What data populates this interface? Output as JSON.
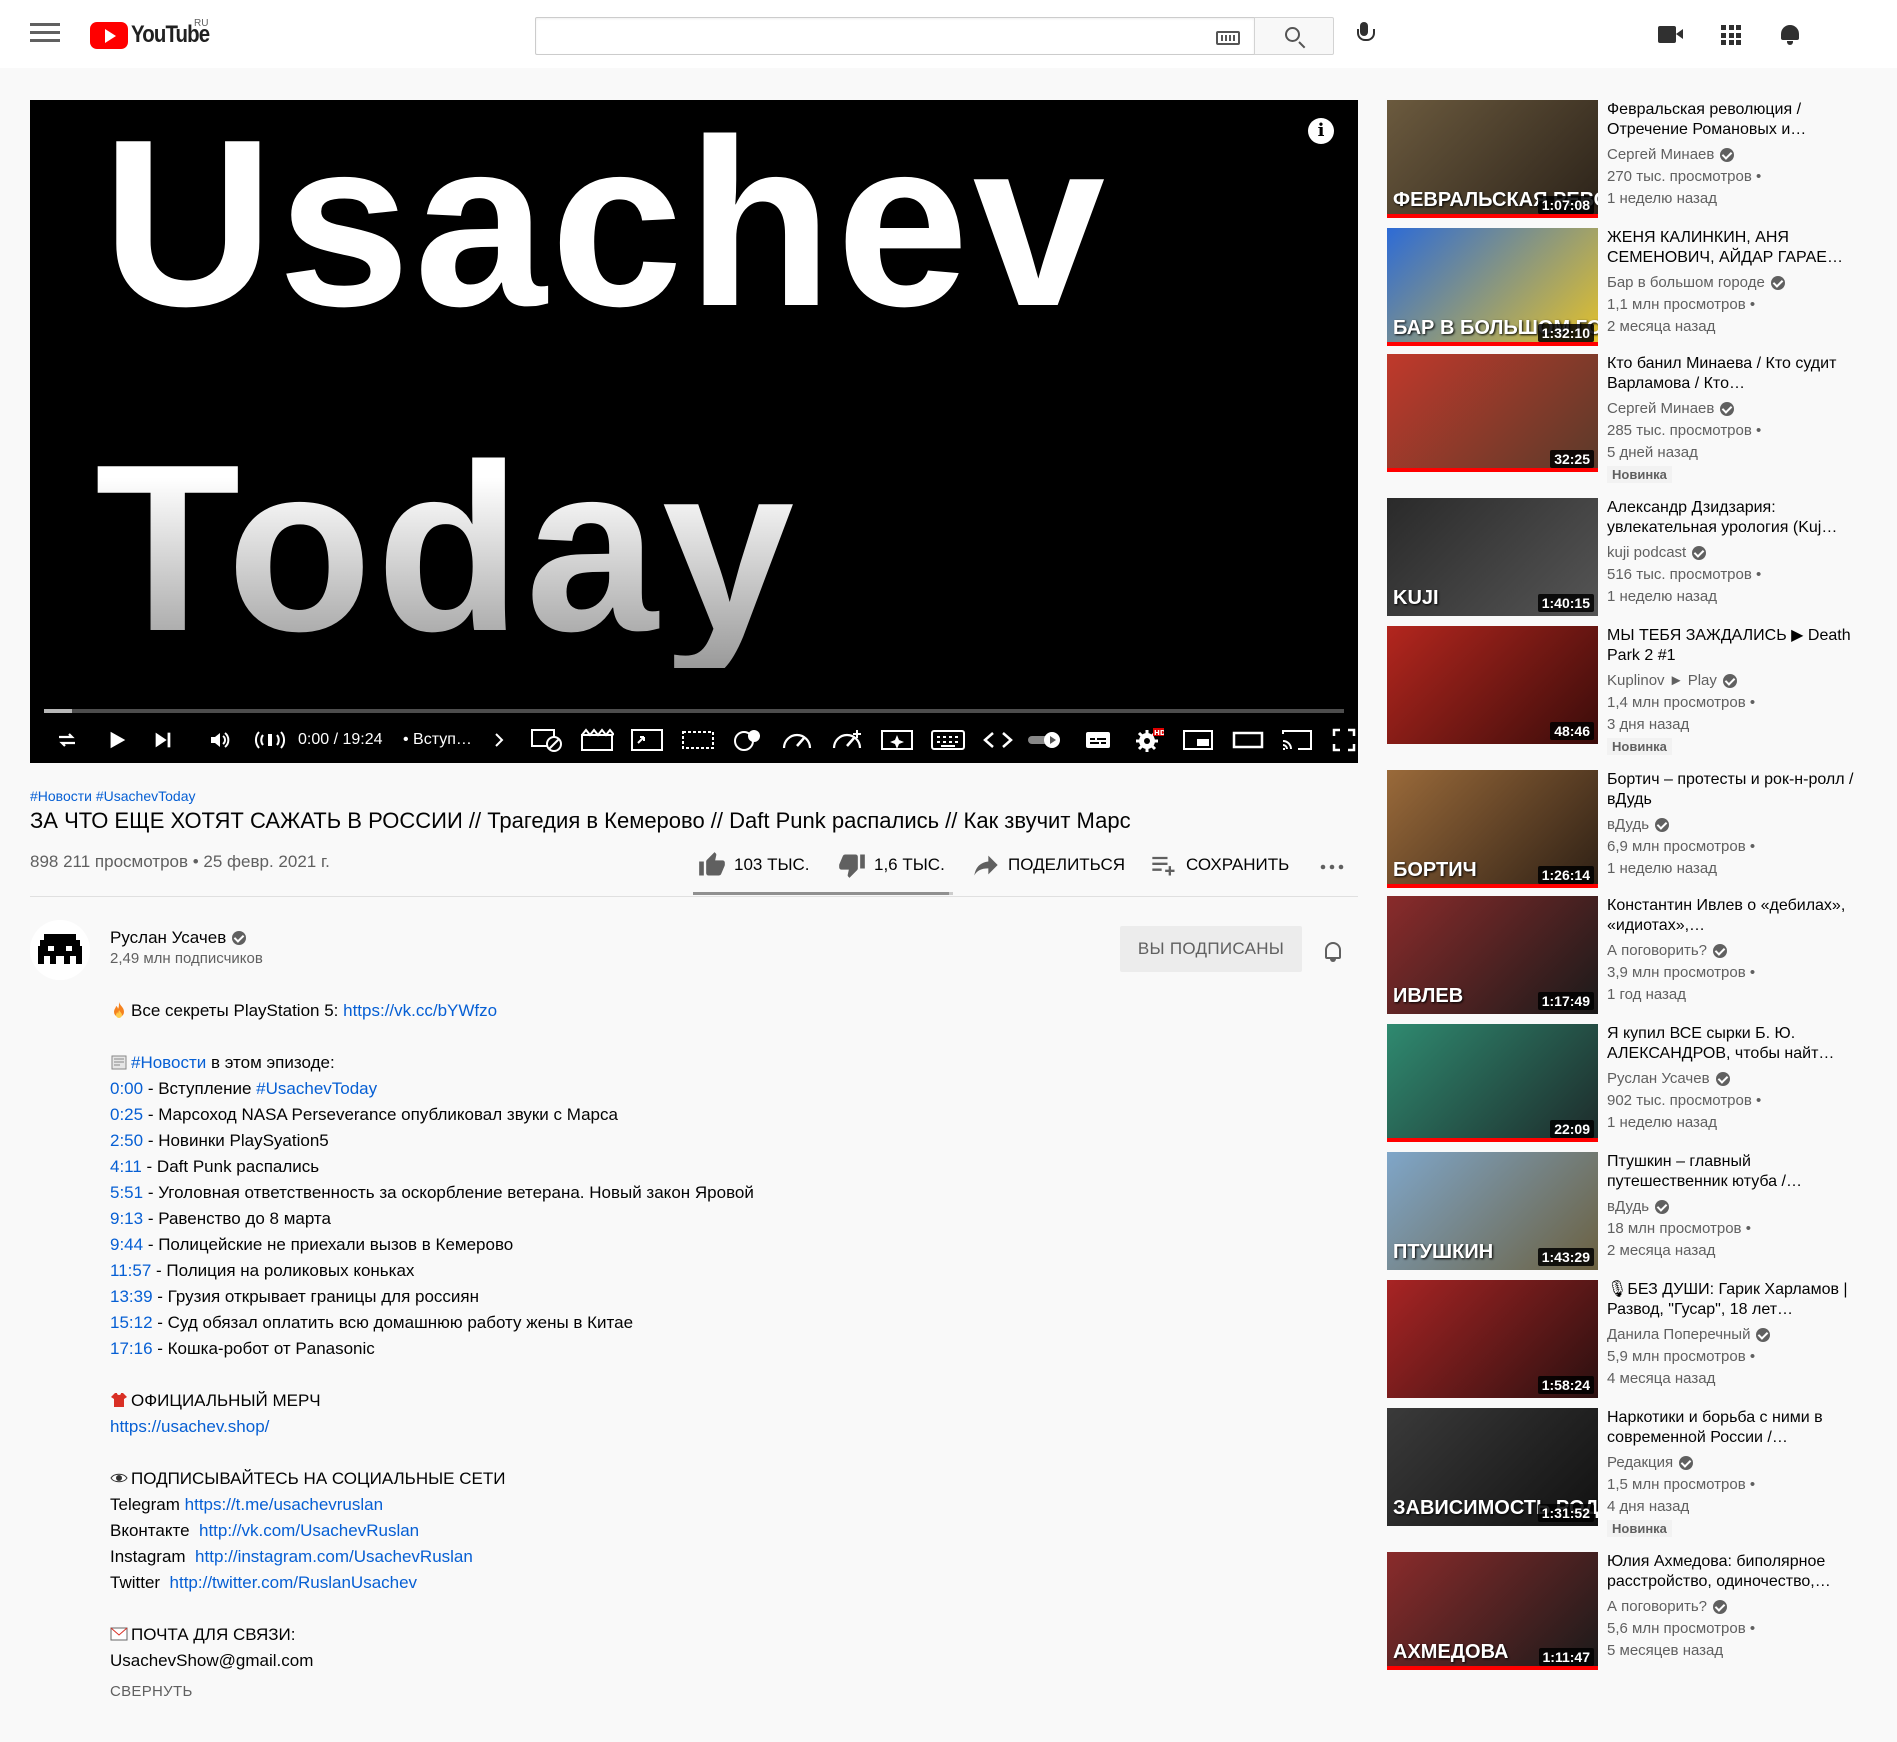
{
  "masthead": {
    "logo_text": "YouTube",
    "region": "RU",
    "search_value": ""
  },
  "player": {
    "thumb_line1": "Usachev",
    "thumb_line2": "Today",
    "time": "0:00 / 19:24",
    "chapter": "• Вступ…",
    "played_fraction": 0.0
  },
  "video": {
    "hashtags": [
      "#Новости",
      "#UsachevToday"
    ],
    "title": "ЗА ЧТО ЕЩЕ ХОТЯТ САЖАТЬ В РОССИИ // Трагедия в Кемерово // Daft Punk распались // Как звучит Марс",
    "views_date": "898 211 просмотров • 25 февр. 2021 г.",
    "likes": "103 ТЫС.",
    "dislikes": "1,6 ТЫС.",
    "share": "ПОДЕЛИТЬСЯ",
    "save": "СОХРАНИТЬ"
  },
  "channel": {
    "name": "Руслан Усачев",
    "subscribers": "2,49 млн подписчиков",
    "subscribed_label": "ВЫ ПОДПИСАНЫ"
  },
  "description": {
    "ps5_text": "Все секреты PlayStation 5: ",
    "ps5_link": "https://vk.cc/bYWfzo",
    "news_tag": "#Новости",
    "news_text": " в этом эпизоде:",
    "chapters": [
      {
        "time": "0:00",
        "text": " - Вступление ",
        "tag": "#UsachevToday"
      },
      {
        "time": "0:25",
        "text": " - Марсоход NASA Perseverance опубликовал звуки с Марса",
        "tag": ""
      },
      {
        "time": "2:50",
        "text": " - Новинки PlaySyation5",
        "tag": ""
      },
      {
        "time": "4:11",
        "text": " - Daft Punk распались",
        "tag": ""
      },
      {
        "time": "5:51",
        "text": " - Уголовная ответственность за оскорбление ветерана. Новый закон Яровой",
        "tag": ""
      },
      {
        "time": "9:13",
        "text": " - Равенство до 8 марта",
        "tag": ""
      },
      {
        "time": "9:44",
        "text": " - Полицейские не приехали вызов в Кемерово",
        "tag": ""
      },
      {
        "time": "11:57",
        "text": " - Полиция на роликовых коньках",
        "tag": ""
      },
      {
        "time": "13:39",
        "text": " - Грузия открывает границы для россиян",
        "tag": ""
      },
      {
        "time": "15:12",
        "text": " - Суд обязал оплатить всю домашнюю работу жены в Китае",
        "tag": ""
      },
      {
        "time": "17:16",
        "text": " - Кошка-робот от Panasonic",
        "tag": ""
      }
    ],
    "merch_title": "ОФИЦИАЛЬНЫЙ МЕРЧ",
    "merch_link": "https://usachev.shop/",
    "social_title": "ПОДПИСЫВАЙТЕСЬ НА СОЦИАЛЬНЫЕ СЕТИ",
    "socials": [
      {
        "label": "Telegram ",
        "link": "https://t.me/usachevruslan"
      },
      {
        "label": "Вконтакте  ",
        "link": "http://vk.com/UsachevRuslan"
      },
      {
        "label": "Instagram  ",
        "link": "http://instagram.com/UsachevRuslan"
      },
      {
        "label": "Twitter  ",
        "link": "http://twitter.com/RuslanUsachev"
      }
    ],
    "mail_title": "ПОЧТА ДЛЯ СВЯЗИ:",
    "mail": "UsachevShow@gmail.com",
    "collapse": "СВЕРНУТЬ"
  },
  "recommendations": [
    {
      "title": "Февральская революция / Отречение Романовых и…",
      "channel": "Сергей Минаев",
      "views": "270 тыс. просмотров •",
      "age": "1 неделю назад",
      "duration": "1:07:08",
      "badge": "",
      "thumb_text": "ФЕВРАЛЬСКАЯ РЕВОЛЮЦИ",
      "color_a": "#6b5a3e",
      "color_b": "#2b2219"
    },
    {
      "title": "ЖЕНЯ КАЛИНКИН, АНЯ СЕМЕНОВИЧ, АЙДАР ГАРАЕ…",
      "channel": "Бар в большом городе",
      "views": "1,1 млн просмотров •",
      "age": "2 месяца назад",
      "duration": "1:32:10",
      "badge": "",
      "thumb_text": "БАР В БОЛЬШОМ ГОРОДЕ",
      "color_a": "#2d6bd6",
      "color_b": "#e5c229"
    },
    {
      "title": "Кто банил Минаева / Кто судит Варламова / Кто…",
      "channel": "Сергей Минаев",
      "views": "285 тыс. просмотров •",
      "age": "5 дней назад",
      "duration": "32:25",
      "badge": "Новинка",
      "thumb_text": "",
      "color_a": "#c0392b",
      "color_b": "#5a3a2a"
    },
    {
      "title": "Александр Дзидзария: увлекательная урология (Kuj…",
      "channel": "kuji podcast",
      "views": "516 тыс. просмотров •",
      "age": "1 неделю назад",
      "duration": "1:40:15",
      "badge": "",
      "thumb_text": "KUJI",
      "color_a": "#2a2a2a",
      "color_b": "#555555"
    },
    {
      "title": "МЫ ТЕБЯ ЗАЖДАЛИСЬ ▶ Death Park 2 #1",
      "channel": "Kuplinov ► Play",
      "views": "1,4 млн просмотров •",
      "age": "3 дня назад",
      "duration": "48:46",
      "badge": "Новинка",
      "thumb_text": "",
      "color_a": "#b3261e",
      "color_b": "#3a0c0a"
    },
    {
      "title": "Бортич – протесты и рок-н-ролл / вДудь",
      "channel": "вДудь",
      "views": "6,9 млн просмотров •",
      "age": "1 неделю назад",
      "duration": "1:26:14",
      "badge": "",
      "thumb_text": "БОРТИЧ",
      "color_a": "#9a6a3a",
      "color_b": "#2e2015"
    },
    {
      "title": "Константин Ивлев о «дебилах», «идиотах»,…",
      "channel": "А поговорить?",
      "views": "3,9 млн просмотров •",
      "age": "1 год назад",
      "duration": "1:17:49",
      "badge": "",
      "thumb_text": "ИВЛЕВ",
      "color_a": "#8a2b2b",
      "color_b": "#1a1a1a"
    },
    {
      "title": "Я купил ВСЕ сырки Б. Ю. АЛЕКСАНДРОВ, чтобы найт…",
      "channel": "Руслан Усачев",
      "views": "902 тыс. просмотров •",
      "age": "1 неделю назад",
      "duration": "22:09",
      "badge": "",
      "thumb_text": "",
      "color_a": "#2f8a70",
      "color_b": "#1d2a2a"
    },
    {
      "title": "Птушкин – главный путешественник ютуба /…",
      "channel": "вДудь",
      "views": "18 млн просмотров •",
      "age": "2 месяца назад",
      "duration": "1:43:29",
      "badge": "",
      "thumb_text": "ПТУШКИН",
      "color_a": "#7fa6c9",
      "color_b": "#6b6040"
    },
    {
      "title": "🎙БЕЗ ДУШИ: Гарик Харламов | Развод, \"Гусар\", 18 лет…",
      "channel": "Данила Поперечный",
      "views": "5,9 млн просмотров •",
      "age": "4 месяца назад",
      "duration": "1:58:24",
      "badge": "",
      "thumb_text": "",
      "color_a": "#a82424",
      "color_b": "#2a1010"
    },
    {
      "title": "Наркотики и борьба с ними в современной России /…",
      "channel": "Редакция",
      "views": "1,5 млн просмотров •",
      "age": "4 дня назад",
      "duration": "1:31:52",
      "badge": "Новинка",
      "thumb_text": "ЗАВИСИМОСТЬ РОДИНЫ",
      "color_a": "#3a3a3a",
      "color_b": "#111111"
    },
    {
      "title": "Юлия Ахмедова: биполярное расстройство, одиночество,…",
      "channel": "А поговорить?",
      "views": "5,6 млн просмотров •",
      "age": "5 месяцев назад",
      "duration": "1:11:47",
      "badge": "",
      "thumb_text": "АХМЕДОВА",
      "color_a": "#8a2b2b",
      "color_b": "#1a1a1a"
    }
  ],
  "colors": {
    "brand_red": "#ff0000",
    "link_blue": "#065fd4",
    "secondary_text": "#606060"
  }
}
